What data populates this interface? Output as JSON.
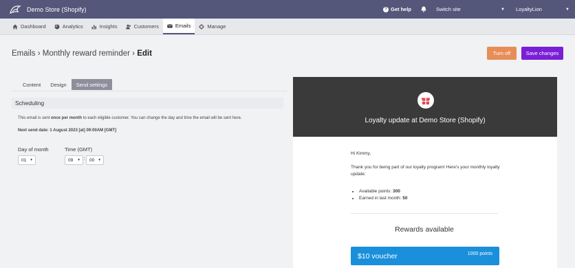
{
  "topbar": {
    "store_name": "Demo Store (Shopify)",
    "help_label": "Get help",
    "site_select": "Switch site",
    "account_select": "LoyaltyLion"
  },
  "nav": {
    "items": [
      {
        "label": "Dashboard",
        "icon": "home-icon"
      },
      {
        "label": "Analytics",
        "icon": "pie-chart-icon"
      },
      {
        "label": "Insights",
        "icon": "bar-chart-icon"
      },
      {
        "label": "Customers",
        "icon": "users-icon"
      },
      {
        "label": "Emails",
        "icon": "envelope-icon",
        "active": true
      },
      {
        "label": "Manage",
        "icon": "gear-icon"
      }
    ]
  },
  "header": {
    "breadcrumb_1": "Emails",
    "sep": "›",
    "breadcrumb_2": "Monthly reward reminder",
    "breadcrumb_3": "Edit",
    "turn_off": "Turn off",
    "save": "Save changes"
  },
  "tabs": {
    "content": "Content",
    "design": "Design",
    "send_settings": "Send settings"
  },
  "scheduling": {
    "heading": "Scheduling",
    "desc_pre": "This email is sent ",
    "desc_bold": "once per month",
    "desc_post": " to each eligible customer. You can change the day and time the email will be sent here.",
    "next_send": "Next send date: 1 August 2023 [at] 09:00AM [GMT]",
    "day_label": "Day of month",
    "time_label": "Time (GMT)",
    "day_value": "01",
    "hour_value": "09",
    "minute_value": "00",
    "colon": ":"
  },
  "preview": {
    "title": "Loyalty update at Demo Store (Shopify)",
    "greeting": "Hi Kimmy,",
    "intro": "Thank you for being part of our loyalty program! Here's your monthly loyalty update:",
    "points_label": "Available points: ",
    "points_value": "300",
    "earned_label": "Earned in last month: ",
    "earned_value": "50",
    "rewards_title": "Rewards available",
    "voucher_name": "$10 voucher",
    "voucher_points": "1000 points"
  },
  "colors": {
    "topbar": "#54567a",
    "primary": "#7a1fd6",
    "turn_off": "#e78d58",
    "voucher": "#1a8fdb",
    "preview_header": "#3a3a3a"
  }
}
